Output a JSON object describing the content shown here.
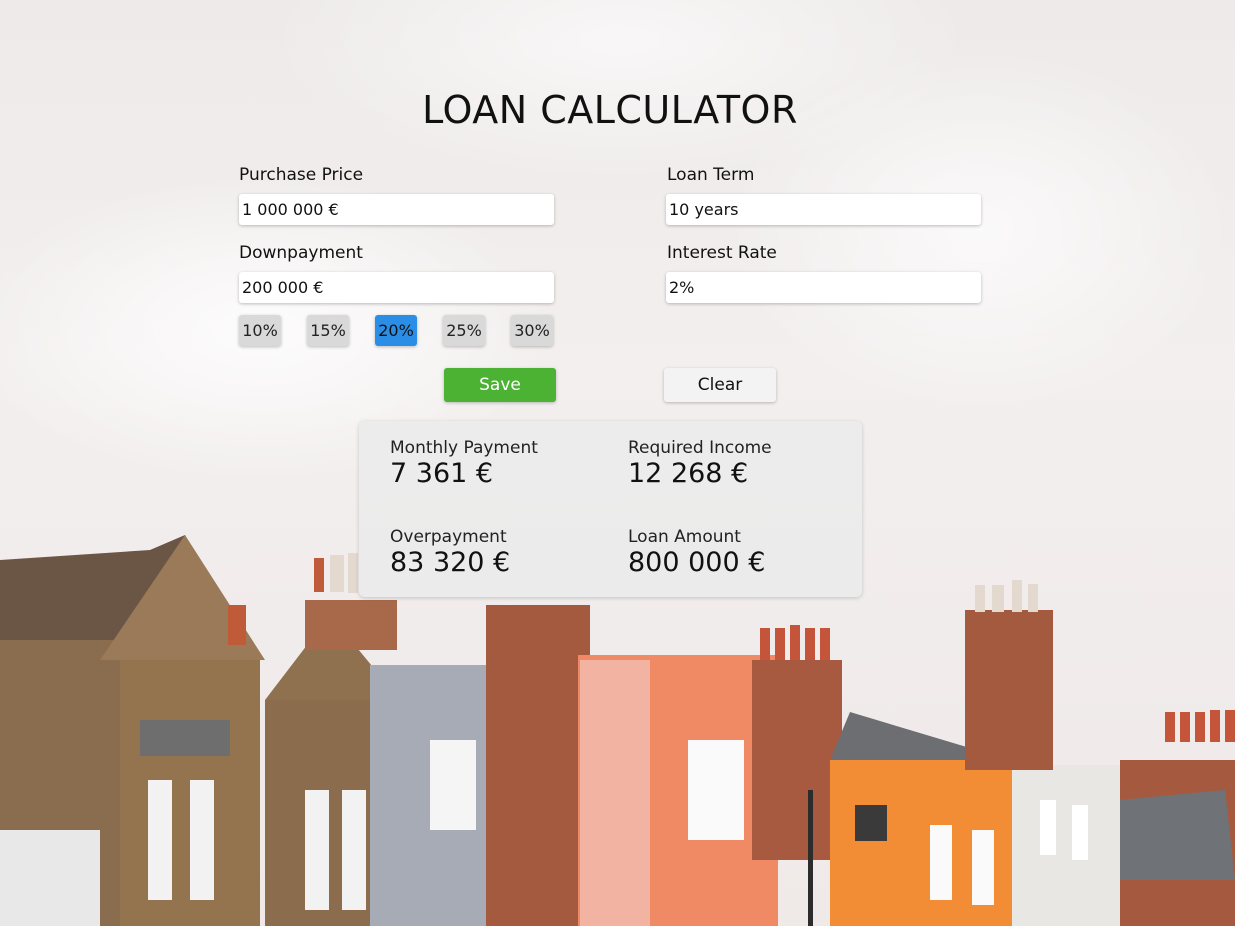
{
  "title": "LOAN CALCULATOR",
  "form": {
    "purchase_price": {
      "label": "Purchase Price",
      "value": "1 000 000 €"
    },
    "downpayment": {
      "label": "Downpayment",
      "value": "200 000 €"
    },
    "loan_term": {
      "label": "Loan Term",
      "value": "10 years"
    },
    "interest_rate": {
      "label": "Interest Rate",
      "value": "2%"
    },
    "downpayment_options": [
      "10%",
      "15%",
      "20%",
      "25%",
      "30%"
    ],
    "selected_option": "20%"
  },
  "buttons": {
    "save": "Save",
    "clear": "Clear"
  },
  "results": {
    "monthly_payment": {
      "label": "Monthly Payment",
      "value": "7 361 €"
    },
    "required_income": {
      "label": "Required Income",
      "value": "12 268 €"
    },
    "overpayment": {
      "label": "Overpayment",
      "value": "83 320 €"
    },
    "loan_amount": {
      "label": "Loan Amount",
      "value": "800 000 €"
    }
  },
  "colors": {
    "save": "#4cb234",
    "selected_option": "#2a8ee6"
  }
}
